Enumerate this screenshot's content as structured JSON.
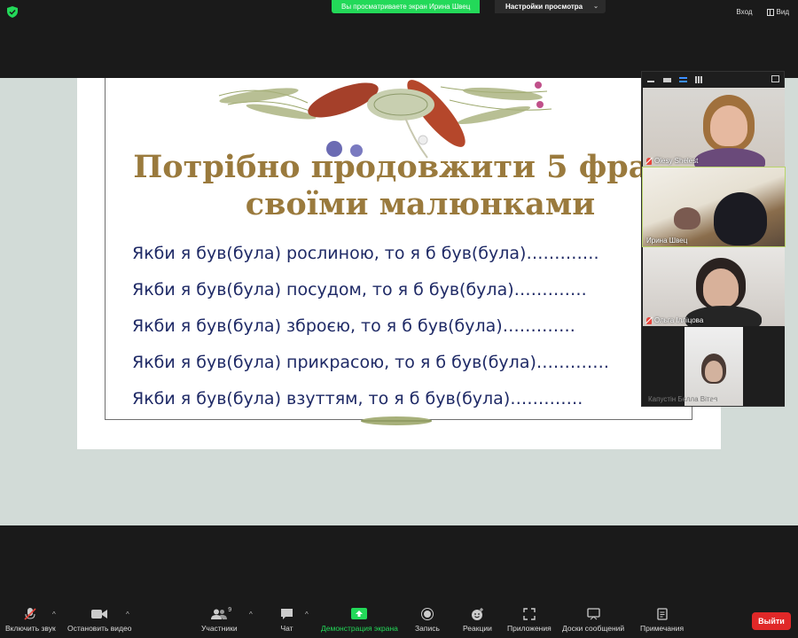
{
  "topbar": {
    "share_banner": "Вы просматриваете экран Ирина Швец",
    "view_settings": "Настройки просмотра",
    "view_settings_caret": "⌄",
    "sign_in": "Вход",
    "view": "Вид"
  },
  "slide": {
    "title_line1": "Потрібно продовжити 5 фраз",
    "title_line2": "своїми малюнками",
    "phrases": [
      "Якби я був(була) рослиною, то я б був(була)………….",
      "Якби я був(була) посудом, то я б був(була)………….",
      "Якби я був(була) зброєю, то я б був(була)………….",
      "Якби я був(була) прикрасою, то я б був(була)………….",
      "Якби я був(була) взуттям, то я б був(була)…………."
    ]
  },
  "gallery": {
    "participants": [
      {
        "name": "Olesy Shelest",
        "muted": true
      },
      {
        "name": "Ирина Швец",
        "muted": false
      },
      {
        "name": "Ольга Ілліцова",
        "muted": true
      },
      {
        "name": "Капустін Бєлла Вітая",
        "muted": false
      }
    ],
    "chevron": "⌄"
  },
  "toolbar": {
    "mute": "Включить звук",
    "video": "Остановить видео",
    "participants": "Участники",
    "participants_count": "9",
    "chat": "Чат",
    "share": "Демонстрация экрана",
    "record": "Запись",
    "reactions": "Реакции",
    "apps": "Приложения",
    "whiteboards": "Доски сообщений",
    "notes": "Примечания",
    "end": "Выйти",
    "caret": "^"
  },
  "colors": {
    "share_green": "#23d959",
    "end_red": "#e02828",
    "title_gold": "#9a7a3d",
    "phrase_navy": "#1f2a66",
    "share_bg": "#d2dbd7"
  }
}
